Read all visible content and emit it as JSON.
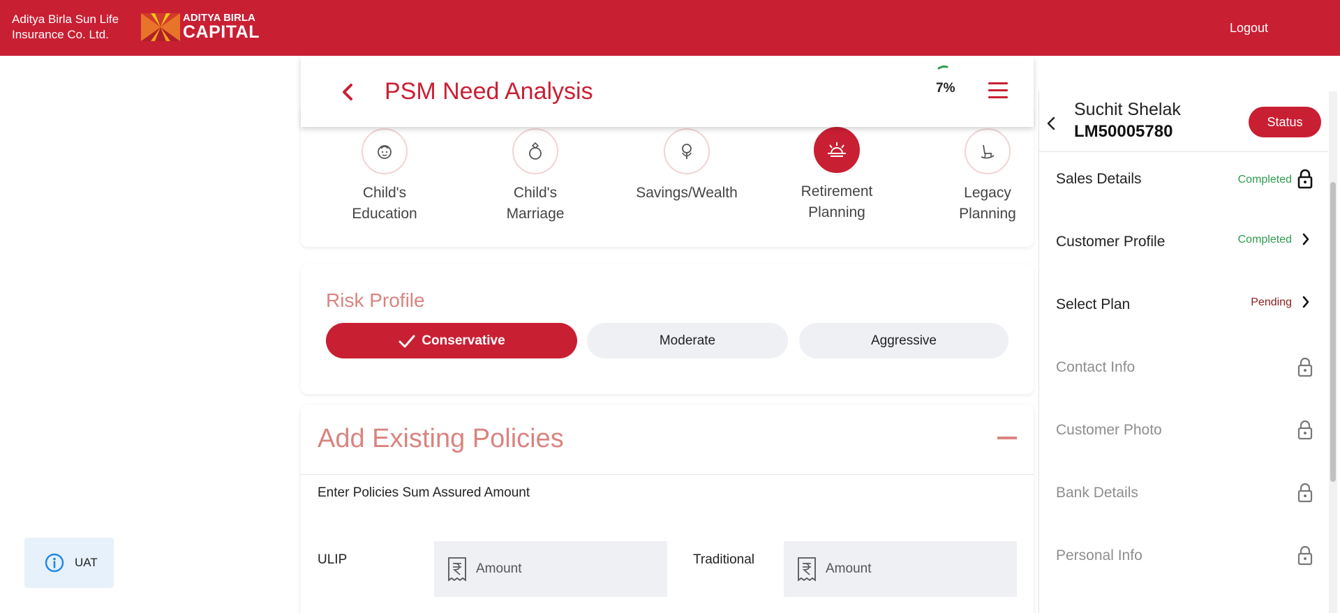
{
  "header": {
    "brand_line1": "Aditya Birla Sun Life",
    "brand_line2": "Insurance Co. Ltd.",
    "logo_line1": "ADITYA BIRLA",
    "logo_line2": "CAPITAL",
    "logout_label": "Logout",
    "brand_color": "#c91f33"
  },
  "title_bar": {
    "title": "PSM Need Analysis",
    "progress": "7%",
    "back_icon": "chevron-left-icon",
    "menu_icon": "hamburger-icon"
  },
  "goals": [
    {
      "line1": "Child's",
      "line2": "Education",
      "icon": "baby-icon",
      "selected": false
    },
    {
      "line1": "Child's",
      "line2": "Marriage",
      "icon": "ring-icon",
      "selected": false
    },
    {
      "line1": "Savings/Wealth",
      "line2": "",
      "icon": "money-plant-icon",
      "selected": false
    },
    {
      "line1": "Retirement",
      "line2": "Planning",
      "icon": "sunset-icon",
      "selected": true
    },
    {
      "line1": "Legacy",
      "line2": "Planning",
      "icon": "rocking-chair-icon",
      "selected": false
    }
  ],
  "risk_profile": {
    "title": "Risk Profile",
    "options": [
      "Conservative",
      "Moderate",
      "Aggressive"
    ],
    "selected": "Conservative"
  },
  "policies": {
    "title": "Add Existing Policies",
    "subtitle": "Enter Policies Sum Assured Amount",
    "ulip_label": "ULIP",
    "ulip_placeholder": "Amount",
    "traditional_label": "Traditional",
    "traditional_placeholder": "Amount"
  },
  "panel": {
    "customer_name": "Suchit Shelak",
    "customer_id": "LM50005780",
    "status_label": "Status",
    "steps": [
      {
        "label": "Sales Details",
        "status": "Completed",
        "state": "done",
        "icon": "lock-icon"
      },
      {
        "label": "Customer Profile",
        "status": "Completed",
        "state": "done",
        "icon": "chevron-right-icon"
      },
      {
        "label": "Select Plan",
        "status": "Pending",
        "state": "pending",
        "icon": "chevron-right-icon"
      },
      {
        "label": "Contact Info",
        "status": "",
        "state": "locked",
        "icon": "lock-icon"
      },
      {
        "label": "Customer Photo",
        "status": "",
        "state": "locked",
        "icon": "lock-icon"
      },
      {
        "label": "Bank Details",
        "status": "",
        "state": "locked",
        "icon": "lock-icon"
      },
      {
        "label": "Personal Info",
        "status": "",
        "state": "locked",
        "icon": "lock-icon"
      }
    ]
  },
  "env_badge": {
    "label": "UAT",
    "icon": "info-icon"
  }
}
